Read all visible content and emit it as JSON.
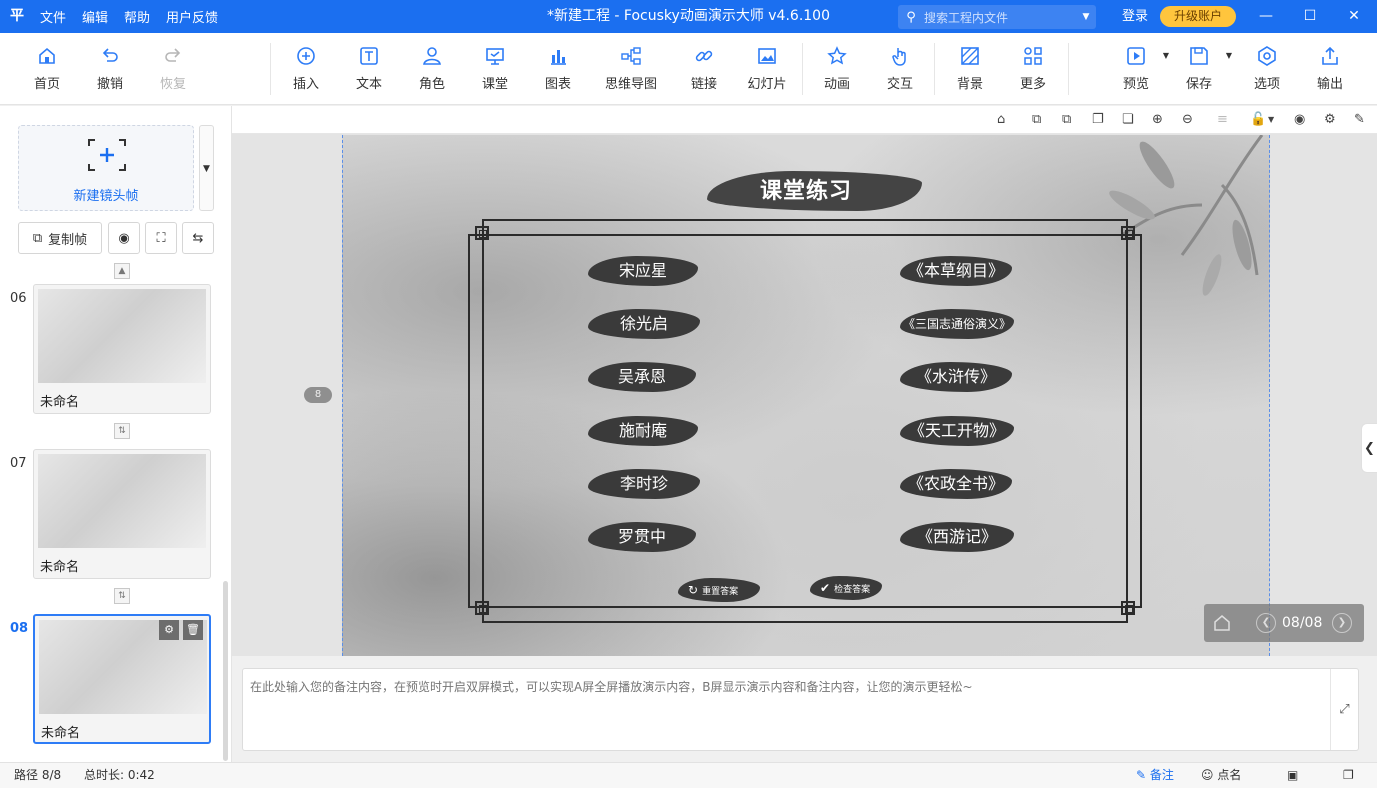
{
  "app": {
    "title": "*新建工程 - Focusky动画演示大师  v4.6.100",
    "logo_glyph": "平",
    "menu": [
      "文件",
      "编辑",
      "帮助",
      "用户反馈"
    ],
    "search_placeholder": "搜索工程内文件",
    "login": "登录",
    "upgrade": "升级账户",
    "colors": {
      "brand": "#1b6ff0",
      "upgrade": "#ffc53d",
      "accent": "#2e7cf6"
    }
  },
  "toolbar": {
    "home": "首页",
    "undo": "撤销",
    "redo": "恢复",
    "insert": "插入",
    "text": "文本",
    "role": "角色",
    "classroom": "课堂",
    "chart": "图表",
    "mindmap": "思维导图",
    "link": "链接",
    "slides": "幻灯片",
    "animation": "动画",
    "interaction": "交互",
    "background": "背景",
    "more": "更多",
    "preview": "预览",
    "save": "保存",
    "options": "选项",
    "export": "输出"
  },
  "left": {
    "new_frame": "新建镜头帧",
    "copy_frame": "复制帧",
    "frames": [
      {
        "num": "06",
        "name": "未命名"
      },
      {
        "num": "07",
        "name": "未命名"
      },
      {
        "num": "08",
        "name": "未命名"
      }
    ]
  },
  "slide": {
    "title": "课堂练习",
    "people": [
      "宋应星",
      "徐光启",
      "吴承恩",
      "施耐庵",
      "李时珍",
      "罗贯中"
    ],
    "books": [
      "《本草纲目》",
      "《三国志通俗演义》",
      "《水浒传》",
      "《天工开物》",
      "《农政全书》",
      "《西游记》"
    ],
    "reset_label": "重置答案",
    "check_label": "检查答案",
    "page_badge": "8",
    "pager": "08/08"
  },
  "notes": {
    "placeholder": "在此处输入您的备注内容，在预览时开启双屏模式，可以实现A屏全屏播放演示内容，B屏显示演示内容和备注内容，让您的演示更轻松~"
  },
  "status": {
    "path": "路径 8/8",
    "duration": "总时长: 0:42",
    "notes": "备注",
    "rollcall": "点名"
  }
}
